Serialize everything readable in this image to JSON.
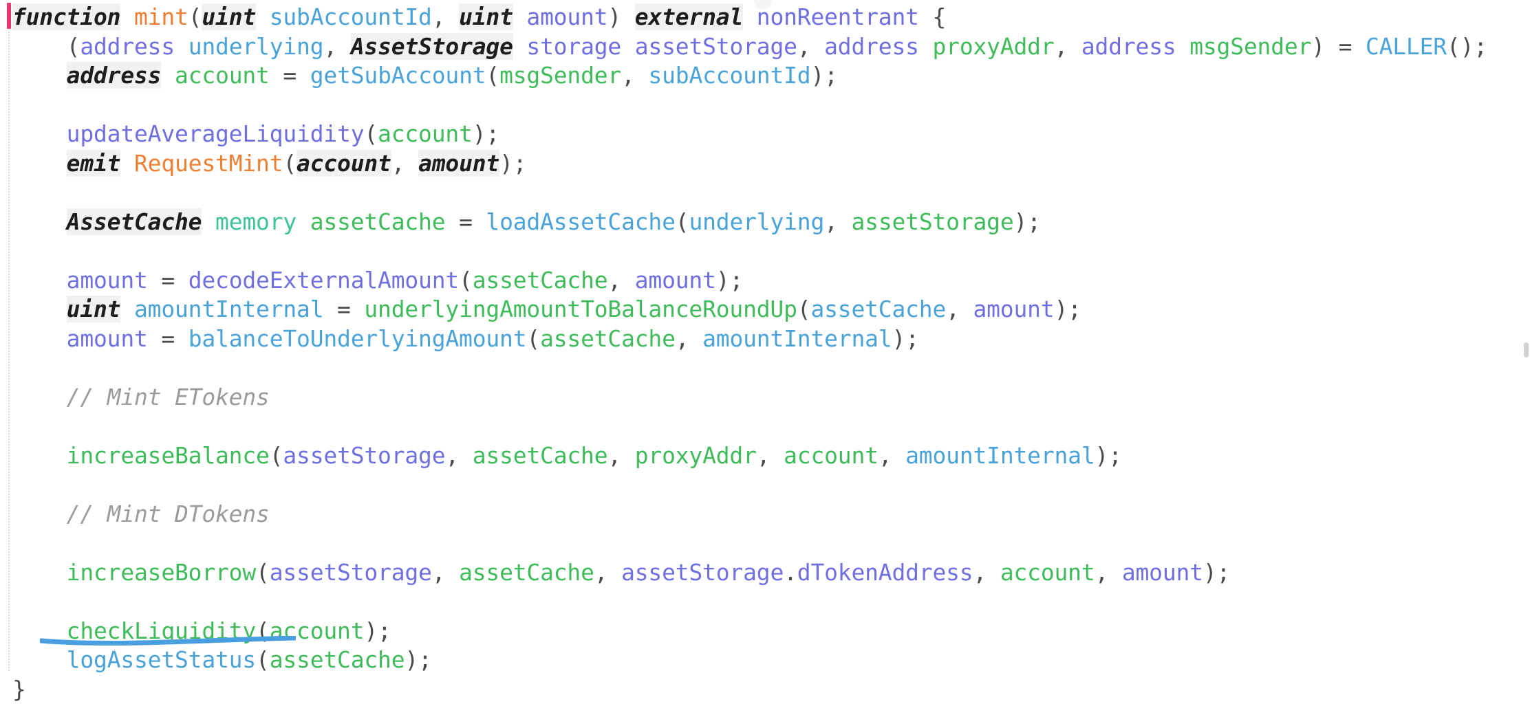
{
  "editor": {
    "language": "Solidity",
    "font_size_px": 33,
    "background": "#ffffff",
    "change_marker_color": "#e8376f",
    "annotation_color": "#4a9fe0",
    "comment_color": "#9b9b9b",
    "colors": {
      "keyword": "#1d1d1d",
      "keyword_background": "#f1f1f1",
      "function_declaration": "#ef8033",
      "call_teal": "#4aa3d8",
      "call_green": "#3fbb5a",
      "call_indigo": "#6f6fe0",
      "variable_green": "#3fbb5a",
      "variable_indigo": "#6f6fe0",
      "variable_lightblue": "#4aa3d8",
      "variable_tealgreen": "#3fc39b",
      "punctuation": "#4a4a4a",
      "comment": "#9b9b9b"
    }
  },
  "annotation": {
    "type": "hand-drawn-underline",
    "target_line": "checkLiquidity(account);",
    "color": "#4a9fe0"
  },
  "code": {
    "lines": [
      {
        "n": 1,
        "text": "function mint(uint subAccountId, uint amount) external nonReentrant {",
        "tokens": [
          {
            "t": "function",
            "c": "kw"
          },
          {
            "t": " ",
            "c": "plain"
          },
          {
            "t": "mint",
            "c": "fnname"
          },
          {
            "t": "(",
            "c": "punct"
          },
          {
            "t": "uint",
            "c": "kw"
          },
          {
            "t": " ",
            "c": "plain"
          },
          {
            "t": "subAccountId",
            "c": "var-t"
          },
          {
            "t": ", ",
            "c": "punct"
          },
          {
            "t": "uint",
            "c": "kw"
          },
          {
            "t": " ",
            "c": "plain"
          },
          {
            "t": "amount",
            "c": "var-b"
          },
          {
            "t": ") ",
            "c": "punct"
          },
          {
            "t": "external",
            "c": "kw"
          },
          {
            "t": " ",
            "c": "plain"
          },
          {
            "t": "nonReentrant",
            "c": "mod"
          },
          {
            "t": " {",
            "c": "punct"
          }
        ]
      },
      {
        "n": 2,
        "text": "    (address underlying, AssetStorage storage assetStorage, address proxyAddr, address msgSender) = CALLER();",
        "tokens": [
          {
            "t": "    (",
            "c": "punct"
          },
          {
            "t": "address",
            "c": "var-b"
          },
          {
            "t": " ",
            "c": "plain"
          },
          {
            "t": "underlying",
            "c": "var-t"
          },
          {
            "t": ", ",
            "c": "punct"
          },
          {
            "t": "AssetStorage",
            "c": "type"
          },
          {
            "t": " ",
            "c": "plain"
          },
          {
            "t": "storage",
            "c": "var-b"
          },
          {
            "t": " ",
            "c": "plain"
          },
          {
            "t": "assetStorage",
            "c": "var-b"
          },
          {
            "t": ", ",
            "c": "punct"
          },
          {
            "t": "address",
            "c": "var-b"
          },
          {
            "t": " ",
            "c": "plain"
          },
          {
            "t": "proxyAddr",
            "c": "var-g"
          },
          {
            "t": ", ",
            "c": "punct"
          },
          {
            "t": "address",
            "c": "var-b"
          },
          {
            "t": " ",
            "c": "plain"
          },
          {
            "t": "msgSender",
            "c": "var-g"
          },
          {
            "t": ") = ",
            "c": "punct"
          },
          {
            "t": "CALLER",
            "c": "call-t"
          },
          {
            "t": "();",
            "c": "punct"
          }
        ]
      },
      {
        "n": 3,
        "text": "    address account = getSubAccount(msgSender, subAccountId);",
        "tokens": [
          {
            "t": "    ",
            "c": "plain"
          },
          {
            "t": "address",
            "c": "kw"
          },
          {
            "t": " ",
            "c": "plain"
          },
          {
            "t": "account",
            "c": "var-g"
          },
          {
            "t": " = ",
            "c": "punct"
          },
          {
            "t": "getSubAccount",
            "c": "call-t"
          },
          {
            "t": "(",
            "c": "punct"
          },
          {
            "t": "msgSender",
            "c": "var-g"
          },
          {
            "t": ", ",
            "c": "punct"
          },
          {
            "t": "subAccountId",
            "c": "var-t"
          },
          {
            "t": ");",
            "c": "punct"
          }
        ]
      },
      {
        "n": 4,
        "text": "",
        "tokens": []
      },
      {
        "n": 5,
        "text": "    updateAverageLiquidity(account);",
        "tokens": [
          {
            "t": "    ",
            "c": "plain"
          },
          {
            "t": "updateAverageLiquidity",
            "c": "call-b"
          },
          {
            "t": "(",
            "c": "punct"
          },
          {
            "t": "account",
            "c": "var-g"
          },
          {
            "t": ");",
            "c": "punct"
          }
        ]
      },
      {
        "n": 6,
        "text": "    emit RequestMint(account, amount);",
        "tokens": [
          {
            "t": "    ",
            "c": "plain"
          },
          {
            "t": "emit",
            "c": "kw"
          },
          {
            "t": " ",
            "c": "plain"
          },
          {
            "t": "RequestMint",
            "c": "fnname"
          },
          {
            "t": "(",
            "c": "punct"
          },
          {
            "t": "account",
            "c": "kw"
          },
          {
            "t": ", ",
            "c": "punct"
          },
          {
            "t": "amount",
            "c": "kw"
          },
          {
            "t": ");",
            "c": "punct"
          }
        ]
      },
      {
        "n": 7,
        "text": "",
        "tokens": []
      },
      {
        "n": 8,
        "text": "    AssetCache memory assetCache = loadAssetCache(underlying, assetStorage);",
        "tokens": [
          {
            "t": "    ",
            "c": "plain"
          },
          {
            "t": "AssetCache",
            "c": "type"
          },
          {
            "t": " ",
            "c": "plain"
          },
          {
            "t": "memory",
            "c": "var-teal"
          },
          {
            "t": " ",
            "c": "plain"
          },
          {
            "t": "assetCache",
            "c": "var-g"
          },
          {
            "t": " = ",
            "c": "punct"
          },
          {
            "t": "loadAssetCache",
            "c": "call-t"
          },
          {
            "t": "(",
            "c": "punct"
          },
          {
            "t": "underlying",
            "c": "var-t"
          },
          {
            "t": ", ",
            "c": "punct"
          },
          {
            "t": "assetStorage",
            "c": "var-g"
          },
          {
            "t": ");",
            "c": "punct"
          }
        ]
      },
      {
        "n": 9,
        "text": "",
        "tokens": []
      },
      {
        "n": 10,
        "text": "    amount = decodeExternalAmount(assetCache, amount);",
        "tokens": [
          {
            "t": "    ",
            "c": "plain"
          },
          {
            "t": "amount",
            "c": "var-b"
          },
          {
            "t": " = ",
            "c": "punct"
          },
          {
            "t": "decodeExternalAmount",
            "c": "call-b"
          },
          {
            "t": "(",
            "c": "punct"
          },
          {
            "t": "assetCache",
            "c": "var-g"
          },
          {
            "t": ", ",
            "c": "punct"
          },
          {
            "t": "amount",
            "c": "var-b"
          },
          {
            "t": ");",
            "c": "punct"
          }
        ]
      },
      {
        "n": 11,
        "text": "    uint amountInternal = underlyingAmountToBalanceRoundUp(assetCache, amount);",
        "tokens": [
          {
            "t": "    ",
            "c": "plain"
          },
          {
            "t": "uint",
            "c": "kw"
          },
          {
            "t": " ",
            "c": "plain"
          },
          {
            "t": "amountInternal",
            "c": "var-t"
          },
          {
            "t": " = ",
            "c": "punct"
          },
          {
            "t": "underlyingAmountToBalanceRoundUp",
            "c": "call-g"
          },
          {
            "t": "(",
            "c": "punct"
          },
          {
            "t": "assetCache",
            "c": "var-t"
          },
          {
            "t": ", ",
            "c": "punct"
          },
          {
            "t": "amount",
            "c": "var-b"
          },
          {
            "t": ");",
            "c": "punct"
          }
        ]
      },
      {
        "n": 12,
        "text": "    amount = balanceToUnderlyingAmount(assetCache, amountInternal);",
        "tokens": [
          {
            "t": "    ",
            "c": "plain"
          },
          {
            "t": "amount",
            "c": "var-b"
          },
          {
            "t": " = ",
            "c": "punct"
          },
          {
            "t": "balanceToUnderlyingAmount",
            "c": "call-t"
          },
          {
            "t": "(",
            "c": "punct"
          },
          {
            "t": "assetCache",
            "c": "var-g"
          },
          {
            "t": ", ",
            "c": "punct"
          },
          {
            "t": "amountInternal",
            "c": "var-t"
          },
          {
            "t": ");",
            "c": "punct"
          }
        ]
      },
      {
        "n": 13,
        "text": "",
        "tokens": []
      },
      {
        "n": 14,
        "text": "    // Mint ETokens",
        "tokens": [
          {
            "t": "    ",
            "c": "plain"
          },
          {
            "t": "// Mint ETokens",
            "c": "cmt"
          }
        ]
      },
      {
        "n": 15,
        "text": "",
        "tokens": []
      },
      {
        "n": 16,
        "text": "    increaseBalance(assetStorage, assetCache, proxyAddr, account, amountInternal);",
        "tokens": [
          {
            "t": "    ",
            "c": "plain"
          },
          {
            "t": "increaseBalance",
            "c": "call-g"
          },
          {
            "t": "(",
            "c": "punct"
          },
          {
            "t": "assetStorage",
            "c": "var-b"
          },
          {
            "t": ", ",
            "c": "punct"
          },
          {
            "t": "assetCache",
            "c": "var-g"
          },
          {
            "t": ", ",
            "c": "punct"
          },
          {
            "t": "proxyAddr",
            "c": "var-g"
          },
          {
            "t": ", ",
            "c": "punct"
          },
          {
            "t": "account",
            "c": "var-g"
          },
          {
            "t": ", ",
            "c": "punct"
          },
          {
            "t": "amountInternal",
            "c": "var-t"
          },
          {
            "t": ");",
            "c": "punct"
          }
        ]
      },
      {
        "n": 17,
        "text": "",
        "tokens": []
      },
      {
        "n": 18,
        "text": "    // Mint DTokens",
        "tokens": [
          {
            "t": "    ",
            "c": "plain"
          },
          {
            "t": "// Mint DTokens",
            "c": "cmt"
          }
        ]
      },
      {
        "n": 19,
        "text": "",
        "tokens": []
      },
      {
        "n": 20,
        "text": "    increaseBorrow(assetStorage, assetCache, assetStorage.dTokenAddress, account, amount);",
        "tokens": [
          {
            "t": "    ",
            "c": "plain"
          },
          {
            "t": "increaseBorrow",
            "c": "call-g"
          },
          {
            "t": "(",
            "c": "punct"
          },
          {
            "t": "assetStorage",
            "c": "var-b"
          },
          {
            "t": ", ",
            "c": "punct"
          },
          {
            "t": "assetCache",
            "c": "var-g"
          },
          {
            "t": ", ",
            "c": "punct"
          },
          {
            "t": "assetStorage",
            "c": "var-b"
          },
          {
            "t": ".",
            "c": "punct"
          },
          {
            "t": "dTokenAddress",
            "c": "var-b"
          },
          {
            "t": ", ",
            "c": "punct"
          },
          {
            "t": "account",
            "c": "var-g"
          },
          {
            "t": ", ",
            "c": "punct"
          },
          {
            "t": "amount",
            "c": "var-b"
          },
          {
            "t": ");",
            "c": "punct"
          }
        ]
      },
      {
        "n": 21,
        "text": "",
        "tokens": []
      },
      {
        "n": 22,
        "text": "    checkLiquidity(account);",
        "tokens": [
          {
            "t": "    ",
            "c": "plain"
          },
          {
            "t": "checkLiquidity",
            "c": "call-g"
          },
          {
            "t": "(",
            "c": "punct"
          },
          {
            "t": "account",
            "c": "var-g"
          },
          {
            "t": ");",
            "c": "punct"
          }
        ]
      },
      {
        "n": 23,
        "text": "    logAssetStatus(assetCache);",
        "tokens": [
          {
            "t": "    ",
            "c": "plain"
          },
          {
            "t": "logAssetStatus",
            "c": "call-t"
          },
          {
            "t": "(",
            "c": "punct"
          },
          {
            "t": "assetCache",
            "c": "var-g"
          },
          {
            "t": ");",
            "c": "punct"
          }
        ]
      },
      {
        "n": 24,
        "text": "}",
        "tokens": [
          {
            "t": "}",
            "c": "punct"
          }
        ]
      }
    ]
  }
}
